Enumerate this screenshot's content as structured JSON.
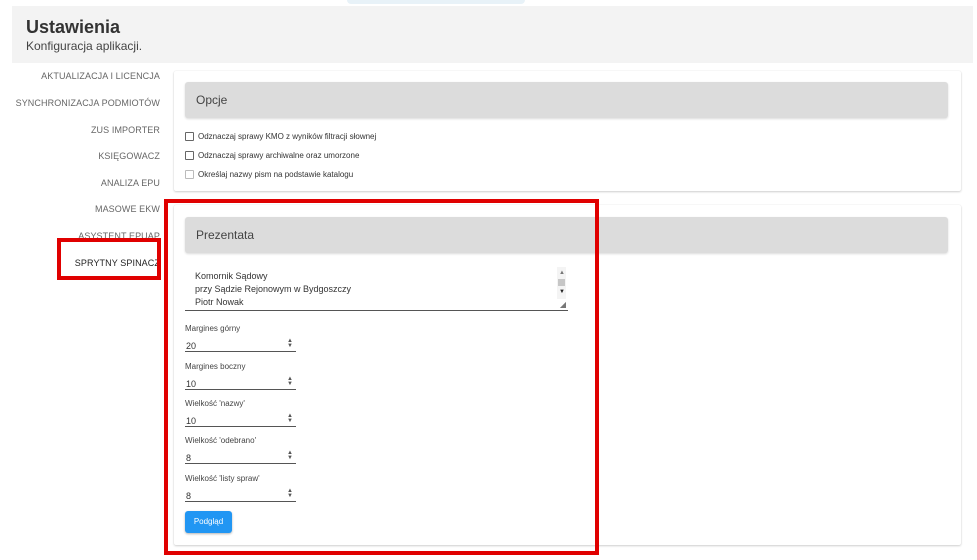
{
  "header": {
    "title": "Ustawienia",
    "subtitle": "Konfiguracja aplikacji."
  },
  "sidebar": {
    "items": [
      {
        "label": "AKTUALIZACJA I LICENCJA"
      },
      {
        "label": "SYNCHRONIZACJA PODMIOTÓW"
      },
      {
        "label": "ZUS IMPORTER"
      },
      {
        "label": "KSIĘGOWACZ"
      },
      {
        "label": "ANALIZA EPU"
      },
      {
        "label": "MASOWE EKW"
      },
      {
        "label": "ASYSTENT EPUAP"
      },
      {
        "label": "SPRYTNY SPINACZ",
        "active": true
      }
    ]
  },
  "opcje": {
    "title": "Opcje",
    "checkboxes": [
      {
        "label": "Odznaczaj sprawy KMO z wyników filtracji słownej",
        "checked": false,
        "disabled": false
      },
      {
        "label": "Odznaczaj sprawy archiwalne oraz umorzone",
        "checked": false,
        "disabled": false
      },
      {
        "label": "Określaj nazwy pism na podstawie katalogu",
        "checked": false,
        "disabled": true
      }
    ]
  },
  "prezentata": {
    "title": "Prezentata",
    "textarea_lines": [
      "Komornik Sądowy",
      "przy Sądzie Rejonowym w Bydgoszczy",
      "Piotr Nowak"
    ],
    "fields": [
      {
        "label": "Margines górny",
        "value": "20"
      },
      {
        "label": "Margines boczny",
        "value": "10"
      },
      {
        "label": "Wielkość 'nazwy'",
        "value": "10"
      },
      {
        "label": "Wielkość 'odebrano'",
        "value": "8"
      },
      {
        "label": "Wielkość 'listy spraw'",
        "value": "8"
      }
    ],
    "preview_button": "Podgląd"
  },
  "colors": {
    "accent": "#2196f3",
    "highlight": "#e00000",
    "header_bg": "#f3f3f3",
    "card_head_bg": "#dcdcdc"
  }
}
